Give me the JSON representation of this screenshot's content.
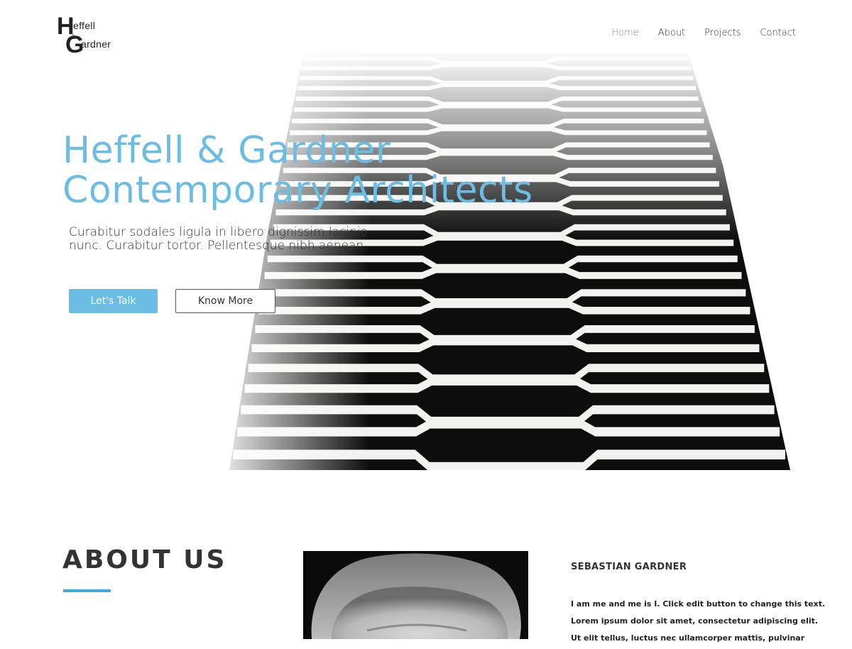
{
  "logo": {
    "letter_h": "H",
    "text_top": "effell",
    "ampersand": "&",
    "letter_g": "G",
    "text_bottom": "ardner"
  },
  "nav": {
    "items": [
      {
        "label": "Home",
        "active": true
      },
      {
        "label": "About",
        "active": false
      },
      {
        "label": "Projects",
        "active": false
      },
      {
        "label": "Contact",
        "active": false
      }
    ]
  },
  "hero": {
    "title_line1": "Heffell & Gardner",
    "title_line2": "Contemporary Architects",
    "subtitle_line1": "Curabitur sodales ligula in libero dignissim lacinia",
    "subtitle_line2": "nunc. Curabitur tortor. Pellentesque nibh aenean.",
    "primary_button": "Let's Talk",
    "secondary_button": "Know More"
  },
  "about": {
    "title": "ABOUT US",
    "person_name": "SEBASTIAN GARDNER",
    "bio": [
      "I am me and me is I. Click edit button to change this text.",
      "Lorem ipsum dolor sit amet, consectetur adipiscing elit.",
      "Ut elit tellus, luctus nec ullamcorper mattis, pulvinar"
    ]
  },
  "colors": {
    "accent": "#6bbde3",
    "underline": "#3fa9dd",
    "text": "#333333"
  }
}
